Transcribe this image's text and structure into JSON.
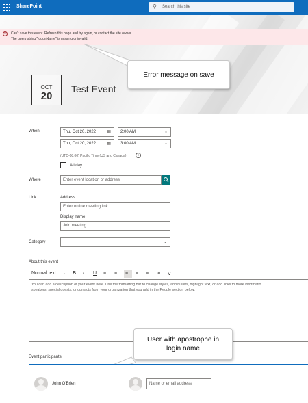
{
  "suite_bar": {
    "app_name": "SharePoint",
    "search_placeholder": "Search this site",
    "search_icon": "search-icon",
    "waffle_icon": "app-launcher-icon"
  },
  "error": {
    "line1": "Can't save this event. Refresh this page and try again, or contact the site owner.",
    "line2": "The query string \"logonName\" is missing or invalid.",
    "icon": "error-circle-icon",
    "color": "#a4262c"
  },
  "event": {
    "month": "OCT",
    "day": "20",
    "title": "Test Event"
  },
  "callouts": {
    "error_note": "Error message on save",
    "user_note_line1": "User with apostrophe in",
    "user_note_line2": "login name"
  },
  "form": {
    "when_label": "When",
    "start_date": "Thu, Oct 20, 2022",
    "start_time": "2:00 AM",
    "end_date": "Thu, Oct 20, 2022",
    "end_time": "3:00 AM",
    "timezone": "(UTC-08:00) Pacific Time (US and Canada)",
    "all_day_label": "All day",
    "where_label": "Where",
    "where_placeholder": "Enter event location or address",
    "link_label": "Link",
    "address_label": "Address",
    "address_placeholder": "Enter online meeting link",
    "display_name_label": "Display name",
    "display_name_placeholder": "Join meeting",
    "category_label": "Category",
    "category_value": ""
  },
  "about": {
    "label": "About this event",
    "text_style": "Normal text",
    "toolbar": [
      "bold-icon",
      "italic-icon",
      "underline-icon",
      "bullet-list-icon",
      "numbered-list-icon",
      "align-left-icon",
      "align-center-icon",
      "align-right-icon",
      "link-icon",
      "clear-format-icon"
    ],
    "bold_glyph": "B",
    "italic_glyph": "I",
    "underline_glyph": "U",
    "line1": "You can add a description of your event here. Use the formatting bar to change styles, add bullets, highlight text, or add links to more informatio",
    "line2": "speakers, special guests, or contacts from your organization that you add in the People section below."
  },
  "participants": {
    "label": "Event participants",
    "person_name": "John O'Brien",
    "add_placeholder": "Name or email address"
  },
  "colors": {
    "brand": "#0f6cbd",
    "error_bg": "#fde7e9",
    "accent_teal": "#03787c"
  }
}
